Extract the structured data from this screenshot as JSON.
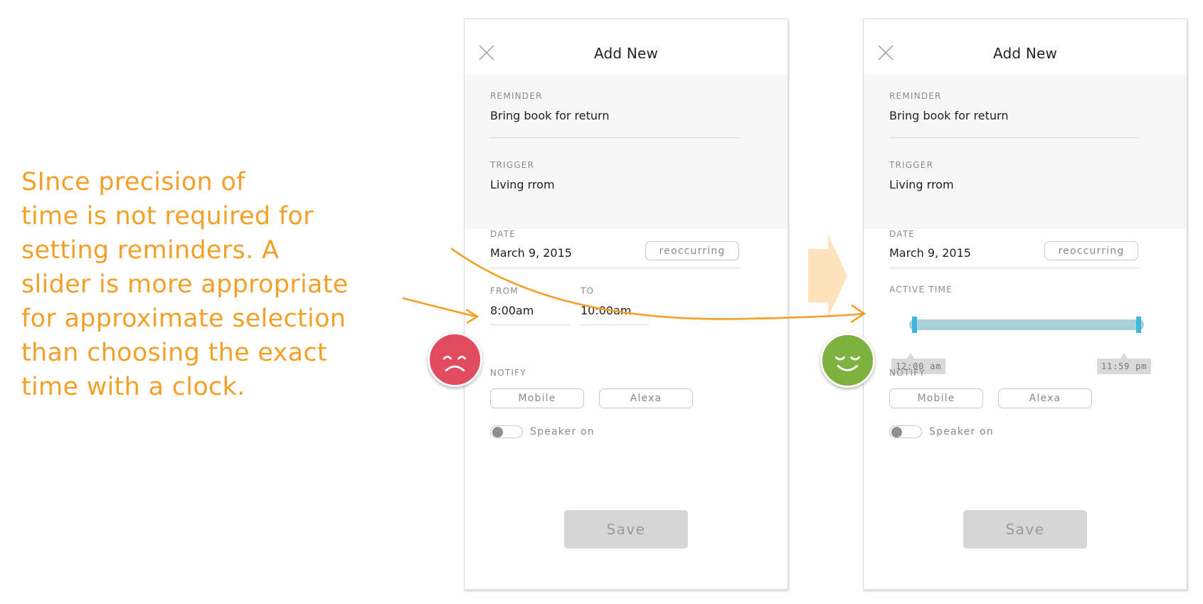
{
  "annotation": {
    "lines": [
      "SInce precision of",
      "time is not required for",
      "setting reminders. A",
      "slider is more appropriate",
      "for approximate selection",
      "than choosing the exact",
      "time with a clock."
    ]
  },
  "colors": {
    "annotation_orange": "#f2a027",
    "sad_face_red": "#e24a5f",
    "happy_face_green": "#7db240",
    "slider_track": "#a9cfd9",
    "slider_handle": "#3fb6dc"
  },
  "icons": {
    "close": "close-icon",
    "sad_face": "sad-face-icon",
    "happy_face": "happy-face-icon"
  },
  "left_card": {
    "title": "Add New",
    "reminder": {
      "label": "REMINDER",
      "value": "Bring book for return"
    },
    "trigger": {
      "label": "TRIGGER",
      "value": "Living rrom"
    },
    "date": {
      "label": "DATE",
      "value": "March 9, 2015",
      "button": "reoccurring"
    },
    "from": {
      "label": "FROM",
      "value": "8:00am"
    },
    "to": {
      "label": "TO",
      "value": "10:00am"
    },
    "notify": {
      "label": "NOTIFY",
      "options": [
        "Mobile",
        "Alexa"
      ]
    },
    "speaker": {
      "label": "Speaker on",
      "on": false
    },
    "save": "Save"
  },
  "right_card": {
    "title": "Add New",
    "reminder": {
      "label": "REMINDER",
      "value": "Bring book for return"
    },
    "trigger": {
      "label": "TRIGGER",
      "value": "Living rrom"
    },
    "date": {
      "label": "DATE",
      "value": "March 9, 2015",
      "button": "reoccurring"
    },
    "active_time": {
      "label": "ACTIVE TIME",
      "start": "12:00 am",
      "end": "11:59 pm",
      "start_fraction": 0.0,
      "end_fraction": 1.0
    },
    "notify": {
      "label": "NOTIFY",
      "options": [
        "Mobile",
        "Alexa"
      ]
    },
    "speaker": {
      "label": "Speaker on",
      "on": false
    },
    "save": "Save"
  }
}
